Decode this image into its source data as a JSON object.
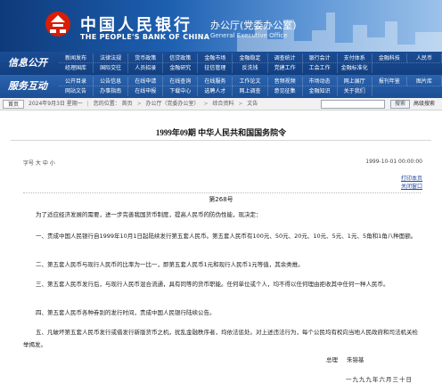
{
  "header": {
    "bank_name_cn": "中国人民银行",
    "bank_name_en": "THE PEOPLE'S BANK OF CHINA",
    "office_cn": "办公厅(党委办公室)",
    "office_en": "General Executive Office",
    "logo_icon": "pboc-logo-icon",
    "accent_color": "#103a7c",
    "logo_color": "#d81e06"
  },
  "nav": {
    "row1_label": "信息公开",
    "row2_label": "服务互动",
    "row1_items": [
      "新闻发布",
      "法律法规",
      "货币政策",
      "信贷政策",
      "金融市场",
      "金融稳定",
      "调查统计",
      "银行会计",
      "支付体系",
      "金融科技",
      "人民币",
      "经理国库",
      "国际交往",
      "人员招录",
      "金融研究",
      "征信管理",
      "反洗钱",
      "党建工作",
      "工会工作",
      "金融标准化"
    ],
    "row2_items": [
      "公开目录",
      "公告信息",
      "在线申请",
      "在线查询",
      "在线服务",
      "工作论文",
      "音频视频",
      "市场动态",
      "网上展厅",
      "报刊年鉴",
      "图片库",
      "网站文告",
      "办事指南",
      "在线申报",
      "下载中心",
      "选聘人才",
      "网上调查",
      "意见征集",
      "金融知识",
      "关于我们"
    ]
  },
  "breadcrumb": {
    "home_label": "首页",
    "date": "2024年9月3日 星期一",
    "location_label": "您的位置：",
    "items": [
      "首页",
      "办公厅（党委办公室）",
      "综合资料",
      "文告"
    ],
    "search_placeholder": "",
    "search_label": "搜索",
    "advanced_search": "高级搜索"
  },
  "document": {
    "title": "1999年09期  中华人民共和国国务院令",
    "font_size_line": "字号 大 中 小",
    "timestamp": "1999-10-01 00:00:00",
    "links": [
      "打印本页",
      "关闭窗口"
    ],
    "number": "第268号",
    "paragraphs": [
      "为了适应经济发展的需要，进一步完善我国货币制度，提高人民币的防伪性能，现决定：",
      "一、责成中国人民银行自1999年10月1日起陆续发行第五套人民币。第五套人民币有100元、50元、20元、10元、5元、1元、5角和1角八种面额。",
      "二、第五套人民币与现行人民币的比率为一比一，即第五套人民币1元和现行人民币1元等值，其余类推。",
      "三、第五套人民币发行后，与现行人民币混合流通，具有同等的货币职能。任何单位或个人，均不得以任何理由拒收其中任何一种人民币。",
      "四、第五套人民币各种券别的发行时间，责成中国人民银行陆续公告。",
      "五、凡破坏第五套人民币发行或借发行新版货币之机，扰乱金融秩序者，均依法惩处。对上述违法行为，每个公民均有权向当地人民政府和司法机关检举揭发。"
    ],
    "signature_title": "总理",
    "signature_name": "朱镕基",
    "date": "一九九九年六月三十日"
  }
}
